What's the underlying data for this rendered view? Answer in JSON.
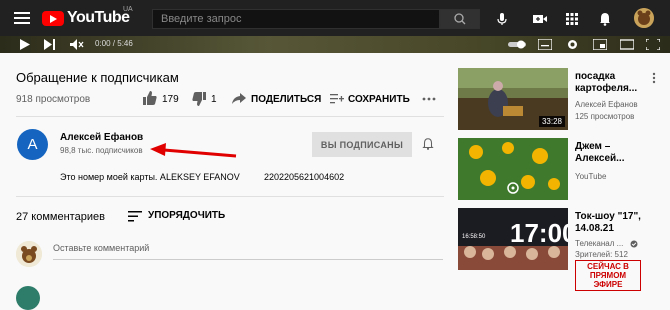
{
  "header": {
    "logo_text": "YouTube",
    "region": "UA",
    "search_placeholder": "Введите запрос"
  },
  "player": {
    "time": "0:00 / 5:46"
  },
  "video": {
    "title": "Обращение к подписчикам",
    "views": "918 просмотров",
    "likes": "179",
    "dislikes": "1",
    "share_label": "ПОДЕЛИТЬСЯ",
    "save_label": "СОХРАНИТЬ"
  },
  "channel": {
    "avatar_letter": "А",
    "name": "Алексей Ефанов",
    "subscribers": "98,8 тыс. подписчиков",
    "subscribed_label": "ВЫ ПОДПИСАНЫ",
    "description": "Это номер моей карты. ALEKSEY EFANOV",
    "card_number": "2202205621004602"
  },
  "comments": {
    "count_label": "27 комментариев",
    "sort_label": "УПОРЯДОЧИТЬ",
    "add_placeholder": "Оставьте комментарий"
  },
  "recommendations": [
    {
      "title_line1": "посадка",
      "title_line2": "картофеля...",
      "channel": "Алексей Ефанов",
      "meta": "125 просмотров",
      "duration": "33:28"
    },
    {
      "title_line1": "Джем –",
      "title_line2": "Алексей...",
      "channel": "YouTube",
      "meta": ""
    },
    {
      "title_line1": "Ток-шоу \"17\",",
      "title_line2": "14.08.21",
      "channel": "Телеканал ...",
      "meta": "Зрителей: 512",
      "live_line1": "СЕЙЧАС В",
      "live_line2": "ПРЯМОМ",
      "live_line3": "ЭФИРЕ",
      "thumb_time": "16:58:50",
      "thumb_big": "17:00"
    }
  ],
  "colors": {
    "brand_red": "#ff0000",
    "header_bg": "#212121",
    "avatar_blue": "#1565c0",
    "arrow_red": "#e10000"
  }
}
